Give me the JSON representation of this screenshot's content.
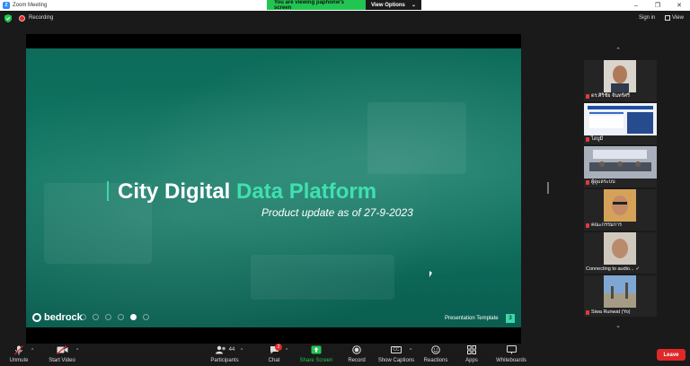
{
  "window": {
    "title": "Zoom Meeting",
    "logo_letter": "Z",
    "controls": [
      "–",
      "❐",
      "✕"
    ]
  },
  "share_banner": {
    "viewing_text": "You are viewing paphonw's screen",
    "view_options_label": "View Options",
    "view_options_caret": "⌄"
  },
  "topbar": {
    "recording_label": "Recording",
    "sign_in_label": "Sign in",
    "view_label": "View"
  },
  "slide": {
    "title_part1": "City Digital",
    "title_part2": "Data Platform",
    "subtitle": "Product update as of 27-9-2023",
    "brand": "bedrock",
    "template_label": "Presentation Template",
    "page_number": "3"
  },
  "participants": [
    {
      "name": "ดร.ศิริชัย จันทร์ศรี",
      "muted": true
    },
    {
      "name": "ไอบูมี",
      "muted": true
    },
    {
      "name": "ผู้ดูแลระบบ",
      "muted": true
    },
    {
      "name": "คณะกรรมการ",
      "muted": true
    },
    {
      "name": "Connecting to audio...",
      "muted": false
    },
    {
      "name": "Siwa Runwat (Yo)",
      "muted": true
    }
  ],
  "strip_nav": {
    "up": "⌃",
    "down": "⌄"
  },
  "toolbar": {
    "unmute_label": "Unmute",
    "start_video_label": "Start Video",
    "participants_label": "Participants",
    "participants_count": "44",
    "chat_label": "Chat",
    "chat_badge": "2",
    "share_label": "Share Screen",
    "record_label": "Record",
    "captions_label": "Show Captions",
    "captions_icon_text": "CC",
    "reactions_label": "Reactions",
    "apps_label": "Apps",
    "whiteboards_label": "Whiteboards",
    "leave_label": "Leave",
    "caret": "^"
  },
  "colors": {
    "accent_green": "#23c552",
    "leave_red": "#e02828",
    "slide_teal": "#0f7663",
    "slide_highlight": "#3fe0b0"
  }
}
